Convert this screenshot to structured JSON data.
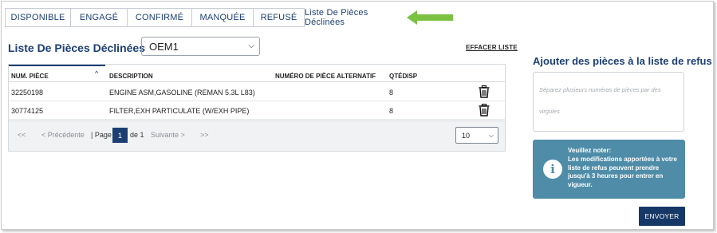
{
  "tabs": [
    {
      "label": "DISPONIBLE"
    },
    {
      "label": "ENGAGÉ"
    },
    {
      "label": "CONFIRMÉ"
    },
    {
      "label": "MANQUÉE"
    },
    {
      "label": "REFUSÉ"
    },
    {
      "label": "Liste De Pièces Déclinées",
      "active": true
    }
  ],
  "main": {
    "title": "Liste De Pièces Déclinées",
    "oem_select": {
      "value": "OEM1"
    },
    "clear_label": "EFFACER LISTE"
  },
  "table": {
    "columns": [
      "NUM. PIÈCE",
      "DESCRIPTION",
      "NUMÉRO DE PIÈCE ALTERNATIF",
      "QTÉDISP"
    ],
    "rows": [
      {
        "part": "32250198",
        "description": "ENGINE ASM,GASOLINE (REMAN 5.3L L83)",
        "alt": "",
        "qty": "8"
      },
      {
        "part": "30774125",
        "description": "FILTER,EXH PARTICULATE (W/EXH PIPE)",
        "alt": "",
        "qty": "8"
      }
    ]
  },
  "pager": {
    "first": "<<",
    "prev": "< Précédente",
    "page_label": "| Page",
    "current": "1",
    "of_label": "de 1",
    "next": "Suivante >",
    "last": ">>",
    "per_page": "10"
  },
  "side": {
    "title": "Ajouter des pièces à la liste de refus",
    "textarea_placeholder": "Séparez plusieurs numéros de pièces par des virgules",
    "note_title": "Veuillez noter:",
    "note_body": "Les modifications apportées à votre liste de refus peuvent prendre jusqu'à 3 heures pour entrer en vigueur.",
    "send_label": "ENVOYER"
  },
  "colors": {
    "primary": "#1c3f73",
    "note_bg": "#4f8ca8",
    "arrow": "#7cc242"
  },
  "icons": [
    "sort-up-icon",
    "trash-icon",
    "info-icon",
    "chevron-down-icon",
    "green-arrow-icon"
  ]
}
